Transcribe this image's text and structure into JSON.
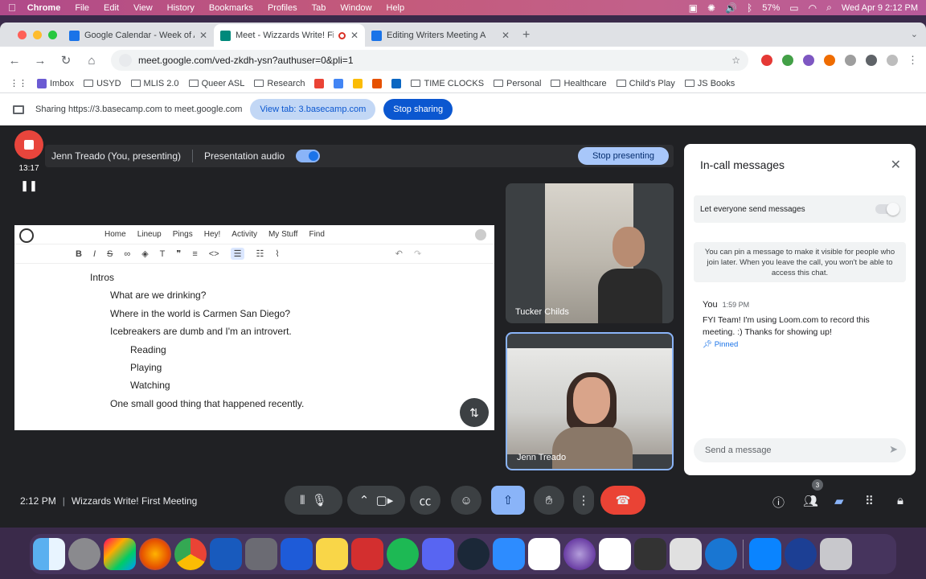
{
  "menubar": {
    "app": "Chrome",
    "items": [
      "File",
      "Edit",
      "View",
      "History",
      "Bookmarks",
      "Profiles",
      "Tab",
      "Window",
      "Help"
    ],
    "battery": "57%",
    "clock": "Wed Apr 9  2:12 PM"
  },
  "tabs": [
    {
      "title": "Google Calendar - Week of A",
      "color": "#1a73e8"
    },
    {
      "title": "Meet - Wizzards Write! Fi",
      "color": "#00897b"
    },
    {
      "title": "Editing Writers Meeting A",
      "color": "#1a73e8"
    }
  ],
  "omnibox": {
    "url": "meet.google.com/ved-zkdh-ysn?authuser=0&pli=1"
  },
  "bookmarks": [
    {
      "label": "Imbox",
      "kind": "app"
    },
    {
      "label": "USYD",
      "kind": "folder"
    },
    {
      "label": "MLIS 2.0",
      "kind": "folder"
    },
    {
      "label": "Queer ASL",
      "kind": "folder"
    },
    {
      "label": "Research",
      "kind": "folder"
    },
    {
      "label": "TIME CLOCKS",
      "kind": "folder"
    },
    {
      "label": "Personal",
      "kind": "folder"
    },
    {
      "label": "Healthcare",
      "kind": "folder"
    },
    {
      "label": "Child's Play",
      "kind": "folder"
    },
    {
      "label": "JS Books",
      "kind": "folder"
    }
  ],
  "sharebar": {
    "text": "Sharing https://3.basecamp.com to meet.google.com",
    "view_tab": "View tab: 3.basecamp.com",
    "stop_sharing": "Stop sharing"
  },
  "loom": {
    "time": "13:17"
  },
  "presenting": {
    "label": "Jenn Treado (You, presenting)",
    "audio_label": "Presentation audio",
    "stop": "Stop presenting"
  },
  "doc": {
    "nav": [
      "Home",
      "Lineup",
      "Pings",
      "Hey!",
      "Activity",
      "My Stuff",
      "Find"
    ],
    "items": [
      {
        "text": "Intros",
        "level": 1
      },
      {
        "text": "What are we drinking?",
        "level": 2
      },
      {
        "text": "Where in the world is Carmen San Diego?",
        "level": 2
      },
      {
        "text": "Icebreakers are dumb and I'm an introvert.",
        "level": 2
      },
      {
        "text": "Reading",
        "level": 3
      },
      {
        "text": "Playing",
        "level": 3
      },
      {
        "text": "Watching",
        "level": 3
      },
      {
        "text": "One small good thing that happened recently.",
        "level": 2
      }
    ]
  },
  "participants": [
    {
      "name": "Tucker Childs"
    },
    {
      "name": "Jenn Treado"
    }
  ],
  "chat": {
    "title": "In-call messages",
    "permission": "Let everyone send messages",
    "info": "You can pin a message to make it visible for people who join later. When you leave the call, you won't be able to access this chat.",
    "sender": "You",
    "time": "1:59 PM",
    "message": "FYI Team! I'm using Loom.com to record this meeting. :) Thanks for showing up!",
    "pinned": "Pinned",
    "placeholder": "Send a message"
  },
  "meeting": {
    "time": "2:12 PM",
    "title": "Wizzards Write! First Meeting",
    "participants_count": "3"
  }
}
